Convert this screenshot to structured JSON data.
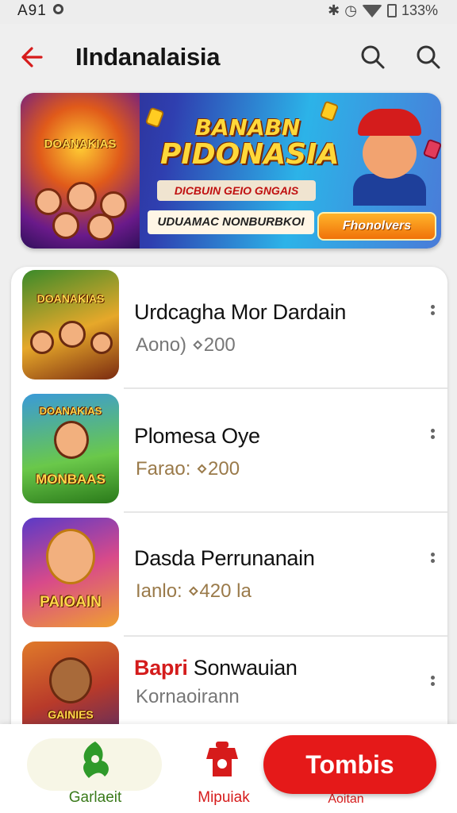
{
  "status_bar": {
    "time": "A91",
    "battery": "133%"
  },
  "app_bar": {
    "title": "Ilndanalaisia"
  },
  "banner": {
    "art_logo": "DOANAKIAS",
    "title_line1": "BANABN",
    "title_line2": "PIDONASIA",
    "pill_text": "DICBUIN GEIO GNGAIS",
    "strip_text": "UDUAMAC NONBURBKOI",
    "cta_label": "Fhonolvers"
  },
  "list": {
    "items": [
      {
        "title": "Urdcagha Mor Dardain",
        "subtitle": "Aono) ⋄200",
        "thumb_label": "DOANAKIAS"
      },
      {
        "title": "Plomesa Oye",
        "subtitle": "Farao: ⋄200",
        "thumb_label": "MONBAAS"
      },
      {
        "title": "Dasda Perrunanain",
        "subtitle": "Ianlo: ⋄420  la",
        "thumb_label": "PAIOAIN"
      },
      {
        "title_accent": "Bapri",
        "title": "Sonwauian",
        "subtitle": "Kornaoirann",
        "thumb_label": "GAINIES"
      }
    ]
  },
  "bottom_nav": {
    "tab1_label": "Garlaeit",
    "tab2_label": "Mipuiak",
    "tab2_sub": "Aoitan",
    "fab_label": "Tombis"
  },
  "colors": {
    "accent": "#e51919",
    "text": "#111111",
    "subtext": "#777777"
  }
}
